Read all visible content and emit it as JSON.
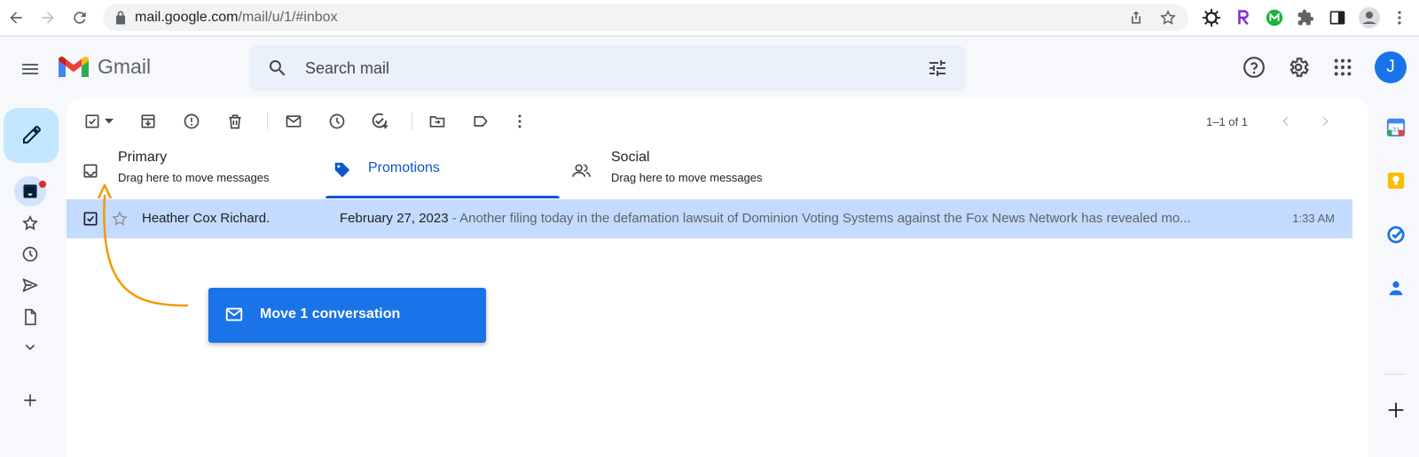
{
  "browser": {
    "url_host": "mail.google.com",
    "url_path": "/mail/u/1/#inbox"
  },
  "gmail": {
    "logo_text": "Gmail",
    "search": {
      "placeholder": "Search mail",
      "value": ""
    },
    "avatar_letter": "J"
  },
  "toolbar": {
    "page_count": "1–1 of 1"
  },
  "tabs": [
    {
      "label": "Primary",
      "subtitle": "Drag here to move messages",
      "active": false
    },
    {
      "label": "Promotions",
      "active": true
    },
    {
      "label": "Social",
      "subtitle": "Drag here to move messages",
      "active": false
    }
  ],
  "emails": [
    {
      "sender": "Heather Cox Richard.",
      "subject": "February 27, 2023",
      "separator": " - ",
      "snippet": "Another filing today in the defamation lawsuit of Dominion Voting Systems against the Fox News Network has revealed mo...",
      "time": "1:33 AM",
      "selected": true
    }
  ],
  "drag_toast": {
    "label": "Move 1 conversation"
  },
  "colors": {
    "accent": "#1a73e8",
    "selected_row": "#c2dbff",
    "compose_bg": "#c2e7ff",
    "active_tab": "#0b57d0",
    "drag_arrow": "#f29900"
  }
}
